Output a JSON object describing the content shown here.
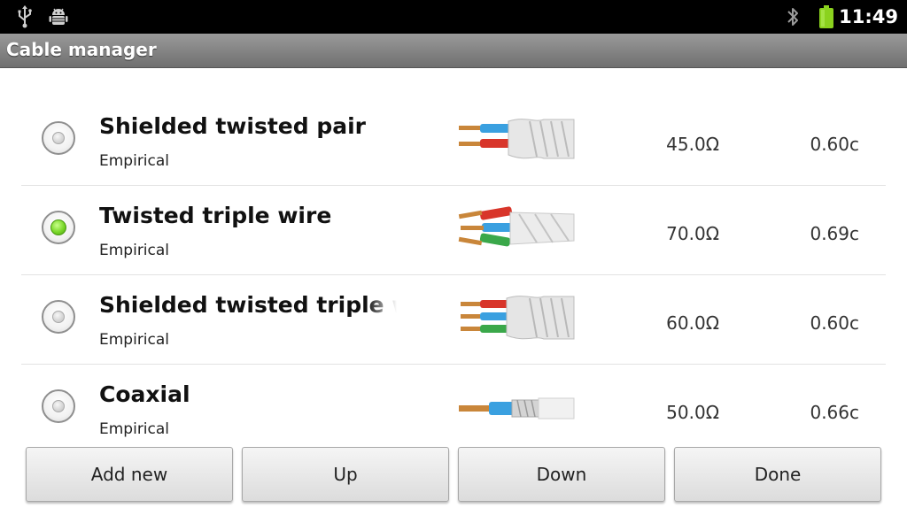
{
  "status_bar": {
    "time": "11:49",
    "icons": [
      "usb-icon",
      "android-debug-icon",
      "bluetooth-icon",
      "battery-icon"
    ]
  },
  "title_bar": {
    "title": "Cable manager"
  },
  "cables": [
    {
      "name": "Shielded twisted pair",
      "source": "Empirical",
      "impedance": "45.0Ω",
      "velocity": "0.60c",
      "selected": false,
      "icon": "shielded-twisted-pair-cable-icon"
    },
    {
      "name": "Twisted triple wire",
      "source": "Empirical",
      "impedance": "70.0Ω",
      "velocity": "0.69c",
      "selected": true,
      "icon": "twisted-triple-wire-cable-icon"
    },
    {
      "name": "Shielded twisted triple wi",
      "source": "Empirical",
      "impedance": "60.0Ω",
      "velocity": "0.60c",
      "selected": false,
      "icon": "shielded-twisted-triple-cable-icon"
    },
    {
      "name": "Coaxial",
      "source": "Empirical",
      "impedance": "50.0Ω",
      "velocity": "0.66c",
      "selected": false,
      "icon": "coaxial-cable-icon"
    }
  ],
  "buttons": {
    "add_new": "Add new",
    "up": "Up",
    "down": "Down",
    "done": "Done"
  },
  "colors": {
    "selected_radio": "#79d728",
    "title_bar": "#8a8a8a",
    "status_bar": "#000000",
    "battery": "#8bd21e"
  }
}
